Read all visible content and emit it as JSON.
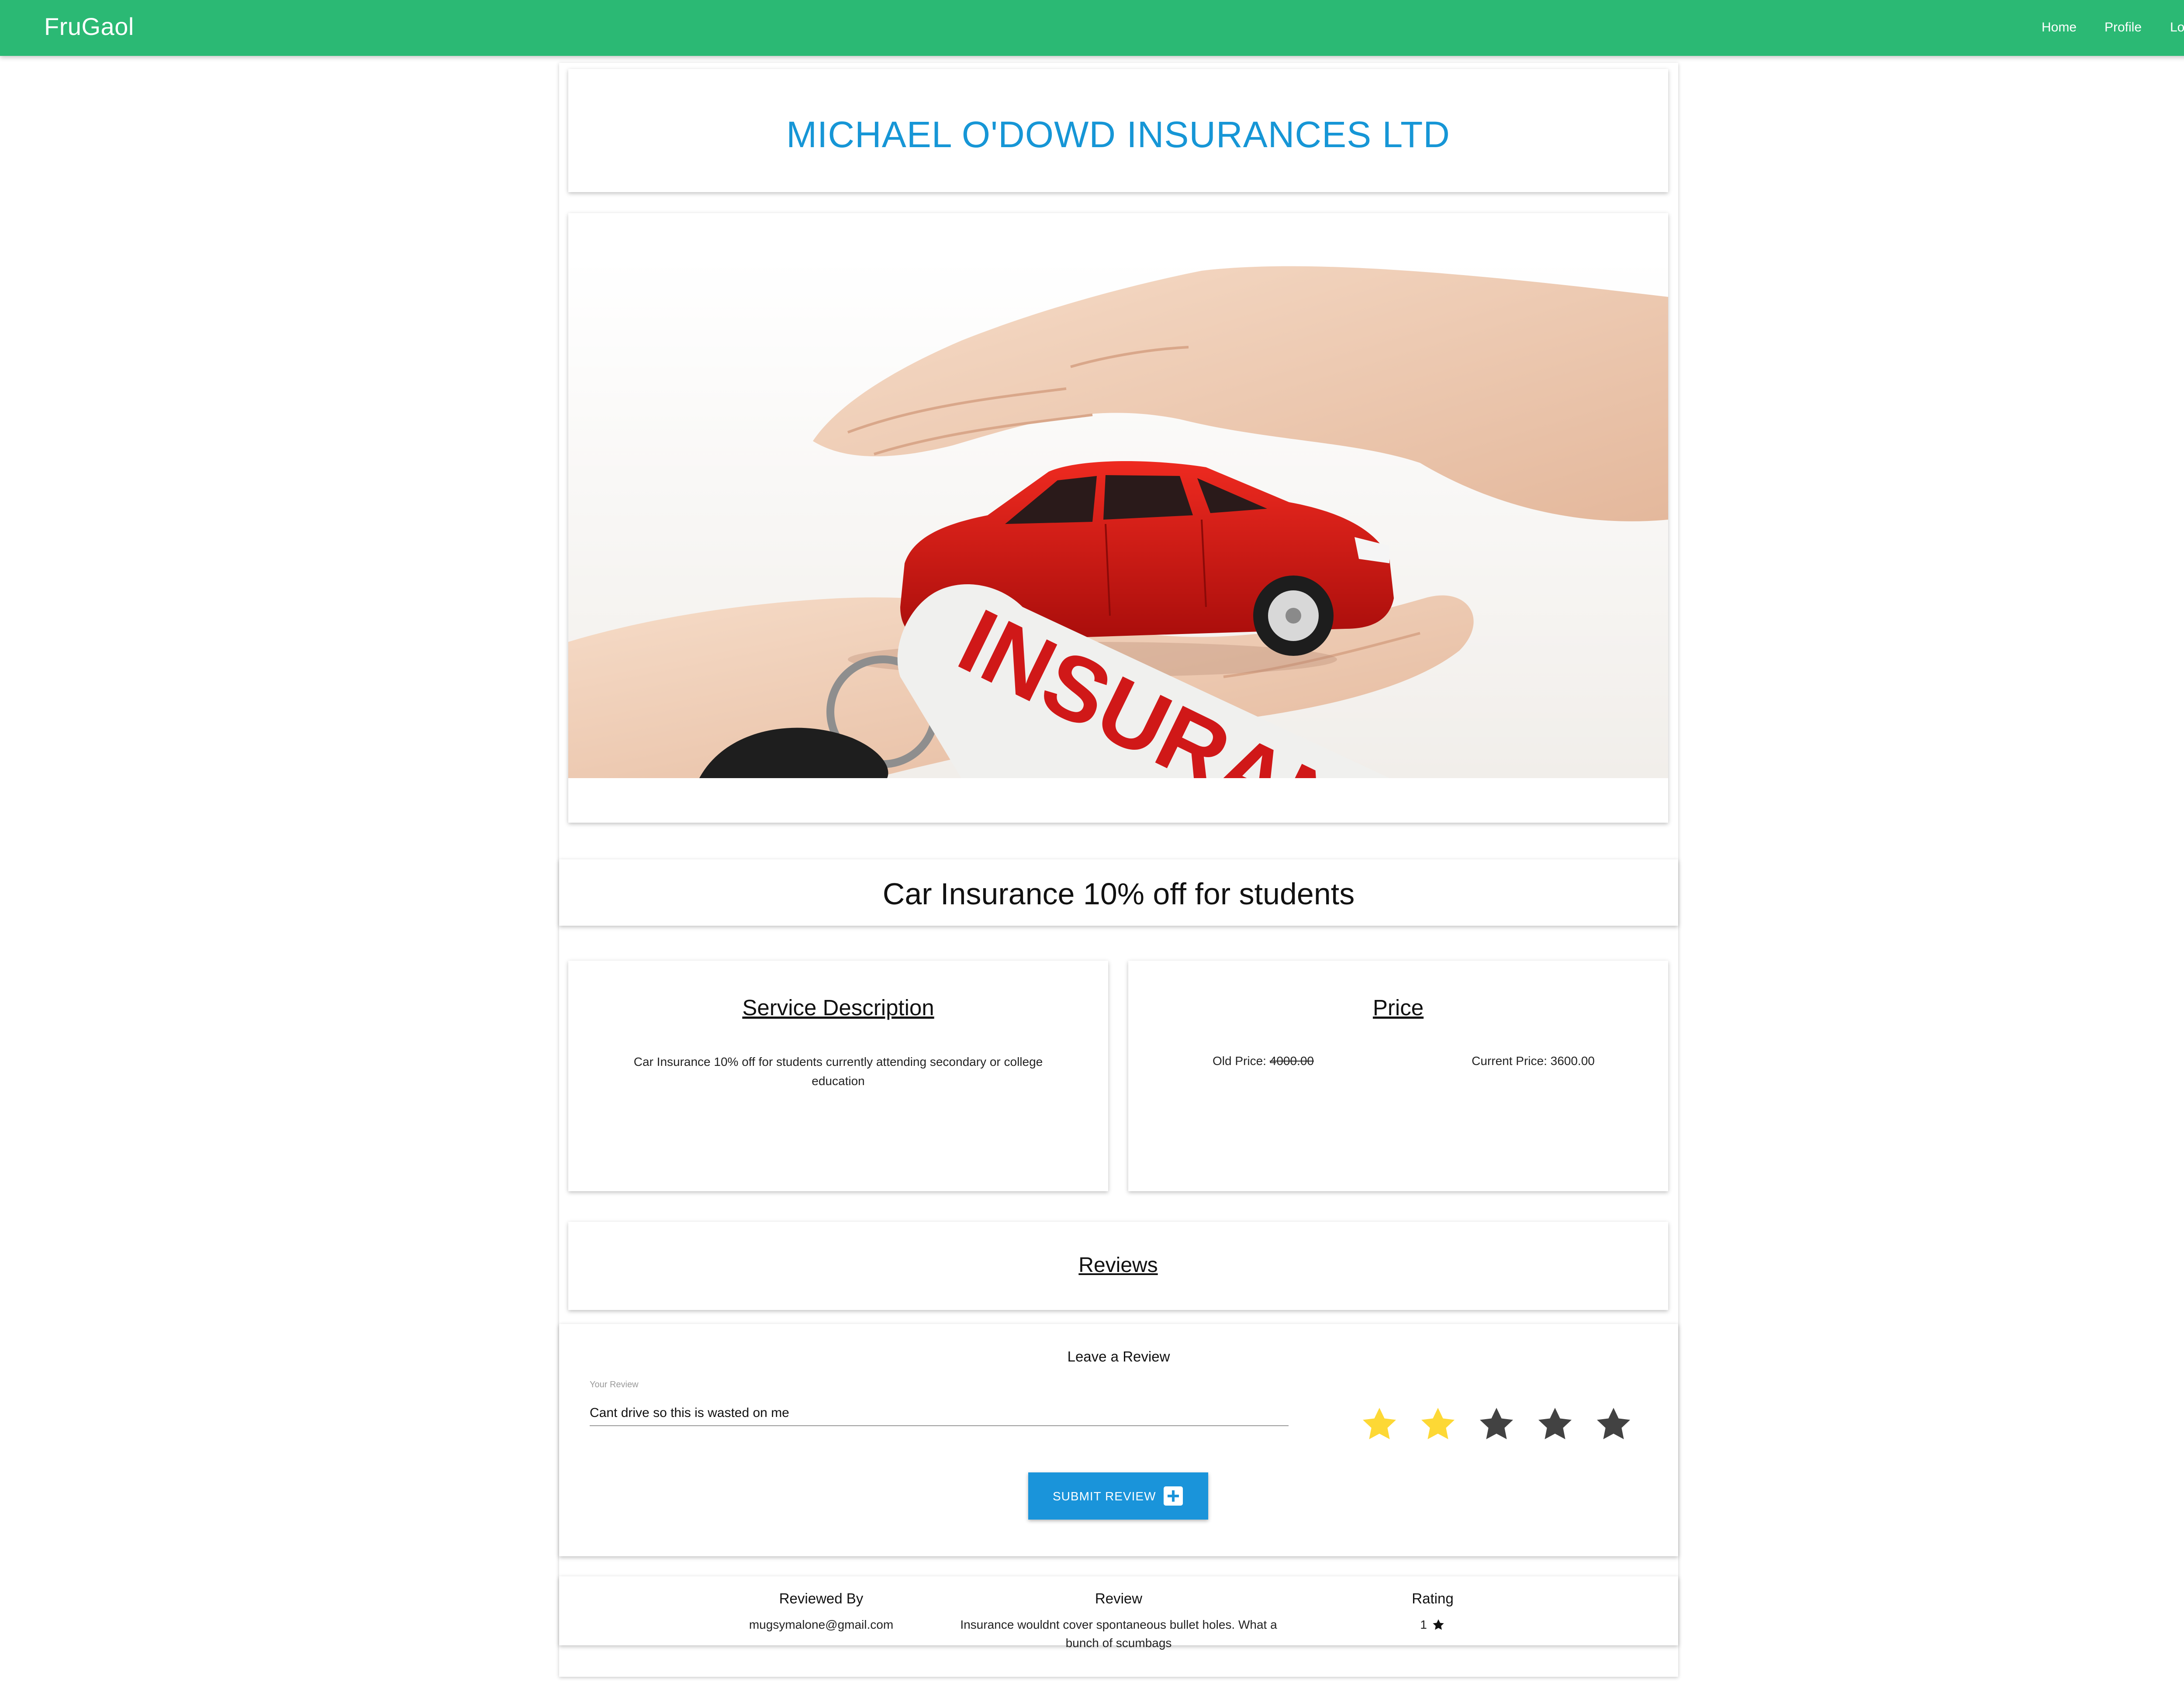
{
  "app": {
    "name": "FruGaol"
  },
  "nav": {
    "home": "Home",
    "profile": "Profile",
    "logout": "Log Out"
  },
  "company": {
    "name": "MICHAEL O'DOWD INSURANCES LTD"
  },
  "offer": {
    "title": "Car Insurance 10% off for students"
  },
  "image": {
    "tag_text": "INSURAN"
  },
  "service": {
    "heading": "Service Description",
    "description": "Car Insurance 10% off for students currently attending secondary or college education"
  },
  "price": {
    "heading": "Price",
    "old_label": "Old Price:",
    "old_value": "4000.00",
    "current_label": "Current Price:",
    "current_value": "3600.00"
  },
  "reviews": {
    "heading": "Reviews"
  },
  "leave_review": {
    "title": "Leave a Review",
    "field_label": "Your Review",
    "input_value": "Cant drive so this is wasted on me",
    "selected_rating": 2,
    "max_rating": 5,
    "submit_label": "SUBMIT REVIEW"
  },
  "review_table": {
    "headers": {
      "reviewed_by": "Reviewed By",
      "review": "Review",
      "rating": "Rating"
    },
    "rows": [
      {
        "reviewed_by": "mugsymalone@gmail.com",
        "review": "Insurance wouldnt cover spontaneous bullet holes. What a bunch of scumbags",
        "rating": "1"
      }
    ]
  },
  "colors": {
    "navbar": "#2bb974",
    "title_blue": "#1696d6",
    "button_blue": "#1a94da",
    "star_filled": "#fdd835",
    "star_empty": "#424242",
    "car_red": "#d61515"
  }
}
